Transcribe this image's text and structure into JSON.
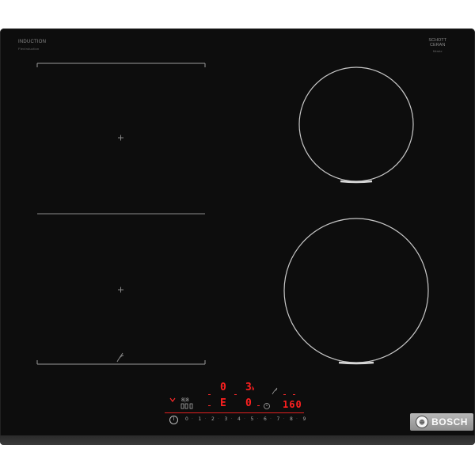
{
  "brand": {
    "induction_label": "INDUCTION",
    "induction_sub": "FlexInduction",
    "schott_label": "SCHOTT",
    "ceran_label": "CERAN",
    "schott_sub": "Miradur",
    "bosch_label": "BOSCH"
  },
  "display": {
    "zone_front_left_level": "0",
    "zone_rear_right_level": "3",
    "zone_rear_right_suffix": "h",
    "zone_rear_left_level": "E",
    "zone_front_right_level": "0",
    "temperature": "160",
    "timer_symbol": "⏲",
    "hob_pan_label": "8|8"
  },
  "slider": {
    "levels": [
      "0",
      "1",
      "2",
      "3",
      "4",
      "5",
      "6",
      "7",
      "8",
      "9"
    ]
  },
  "icons": {
    "flex_bridge": "flexzone-bridge-icon",
    "power": "power-icon"
  }
}
